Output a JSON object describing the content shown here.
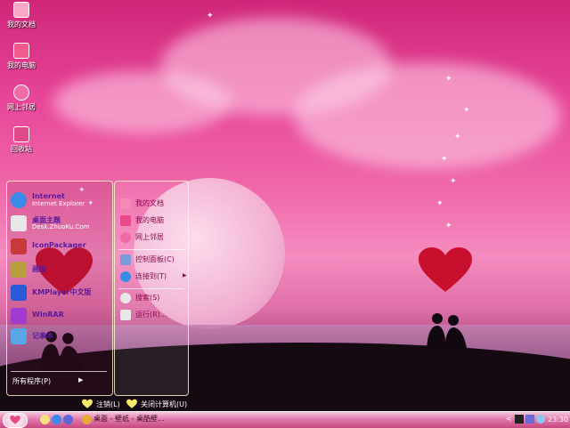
{
  "desktop_icons": [
    {
      "label": "我的文档",
      "color": "#f7a8c8"
    },
    {
      "label": "我的电脑",
      "color": "#f25a8e"
    },
    {
      "label": "网上邻居",
      "color": "#f06aa8"
    },
    {
      "label": "回收站",
      "color": "#e04a8a"
    }
  ],
  "start_menu": {
    "programs": [
      {
        "title": "Internet",
        "subtitle": "Internet Explorer",
        "icon": "internet-explorer-icon",
        "color": "#3a8ae8"
      },
      {
        "title": "桌面主题",
        "subtitle": "Desk.ZhuoKu.Com",
        "icon": "theme-icon",
        "color": "#e8e8e8"
      },
      {
        "title": "IconPackager",
        "subtitle": "",
        "icon": "iconpackager-icon",
        "color": "#c83a3a"
      },
      {
        "title": "画图",
        "subtitle": "",
        "icon": "paint-icon",
        "color": "#b8a040"
      },
      {
        "title": "KMPlayer中文版",
        "subtitle": "",
        "icon": "kmplayer-icon",
        "color": "#2a5ad8"
      },
      {
        "title": "WinRAR",
        "subtitle": "",
        "icon": "winrar-icon",
        "color": "#a03ad0"
      },
      {
        "title": "记事本",
        "subtitle": "",
        "icon": "notepad-icon",
        "color": "#58a8e8"
      }
    ],
    "all_programs": "所有程序(P)",
    "places": [
      {
        "label": "我的文档",
        "icon": "documents-icon",
        "color": "#f48ab8"
      },
      {
        "label": "我的电脑",
        "icon": "computer-icon",
        "color": "#e84a8a"
      },
      {
        "label": "网上邻居",
        "icon": "network-icon",
        "color": "#f06aa8"
      }
    ],
    "settings": [
      {
        "label": "控制面板(C)",
        "icon": "control-panel-icon",
        "color": "#7a9ad8"
      },
      {
        "label": "连接到(T)",
        "icon": "connect-icon",
        "color": "#3a8ae8"
      }
    ],
    "tools": [
      {
        "label": "搜索(S)",
        "icon": "search-icon",
        "color": "#e8e8e8"
      },
      {
        "label": "运行(R)...",
        "icon": "run-icon",
        "color": "#e8e8e8"
      }
    ],
    "logoff": "注销(L)",
    "shutdown": "关闭计算机(U)"
  },
  "taskbar": {
    "task": "桌面 - 壁纸 - 桌酷壁...",
    "clock": "23:30"
  },
  "colors": {
    "accent": "#e8489a",
    "heart": "#c8102e"
  }
}
